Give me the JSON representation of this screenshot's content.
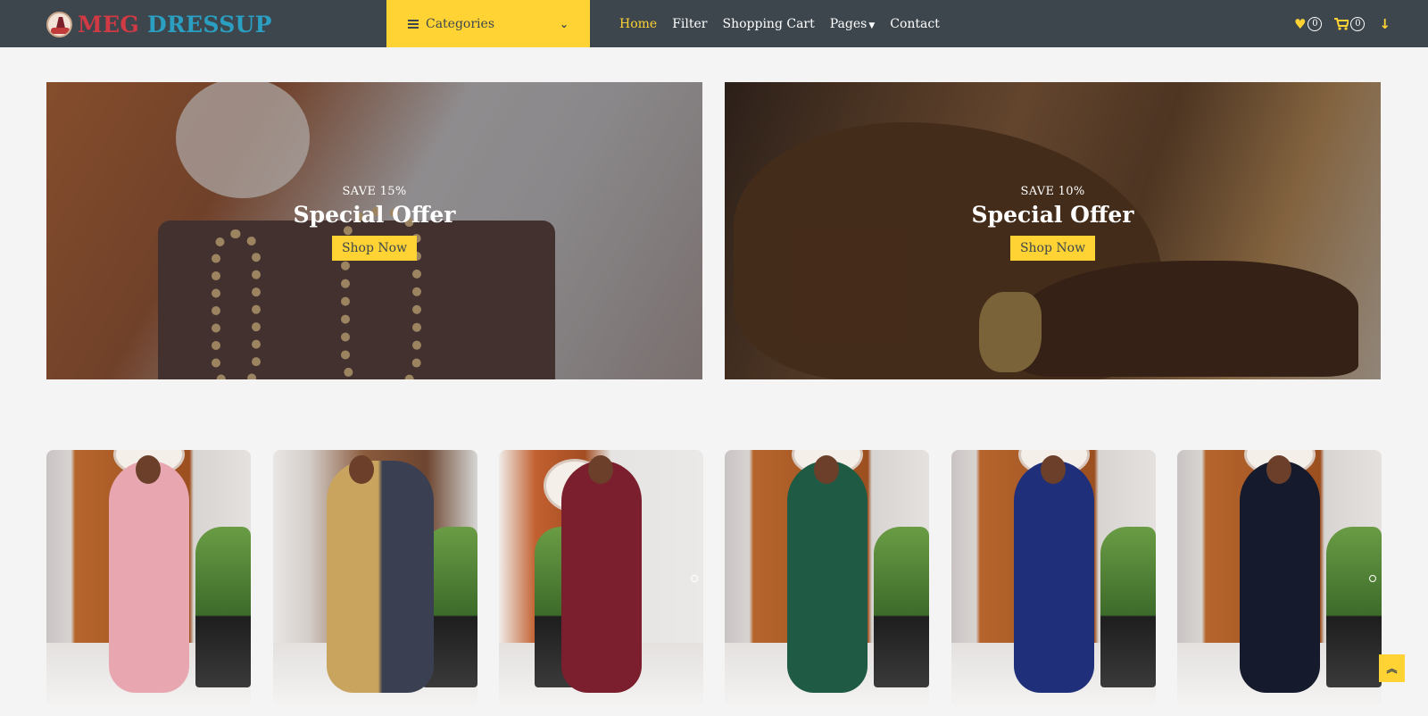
{
  "brand": {
    "word1": "MEG",
    "word2": "DRESSUP"
  },
  "categories": {
    "label": "Categories"
  },
  "nav": {
    "home": "Home",
    "filter": "Filter",
    "cart": "Shopping Cart",
    "pages": "Pages",
    "contact": "Contact"
  },
  "icons": {
    "wishlist": "heart-icon",
    "cart": "shopping-cart-icon",
    "download": "arrow-down-icon",
    "back_to_top": "double-chevron-up-icon"
  },
  "counts": {
    "wishlist": "0",
    "cart": "0"
  },
  "offers": [
    {
      "save": "SAVE 15%",
      "title": "Special Offer",
      "button": "Shop Now"
    },
    {
      "save": "SAVE 10%",
      "title": "Special Offer",
      "button": "Shop Now"
    }
  ],
  "colors": {
    "navbar": "#3d464d",
    "accent": "#ffd333",
    "brand_red": "#d03a44",
    "brand_blue": "#2a9fc1",
    "page_bg": "#f4f4f4"
  }
}
